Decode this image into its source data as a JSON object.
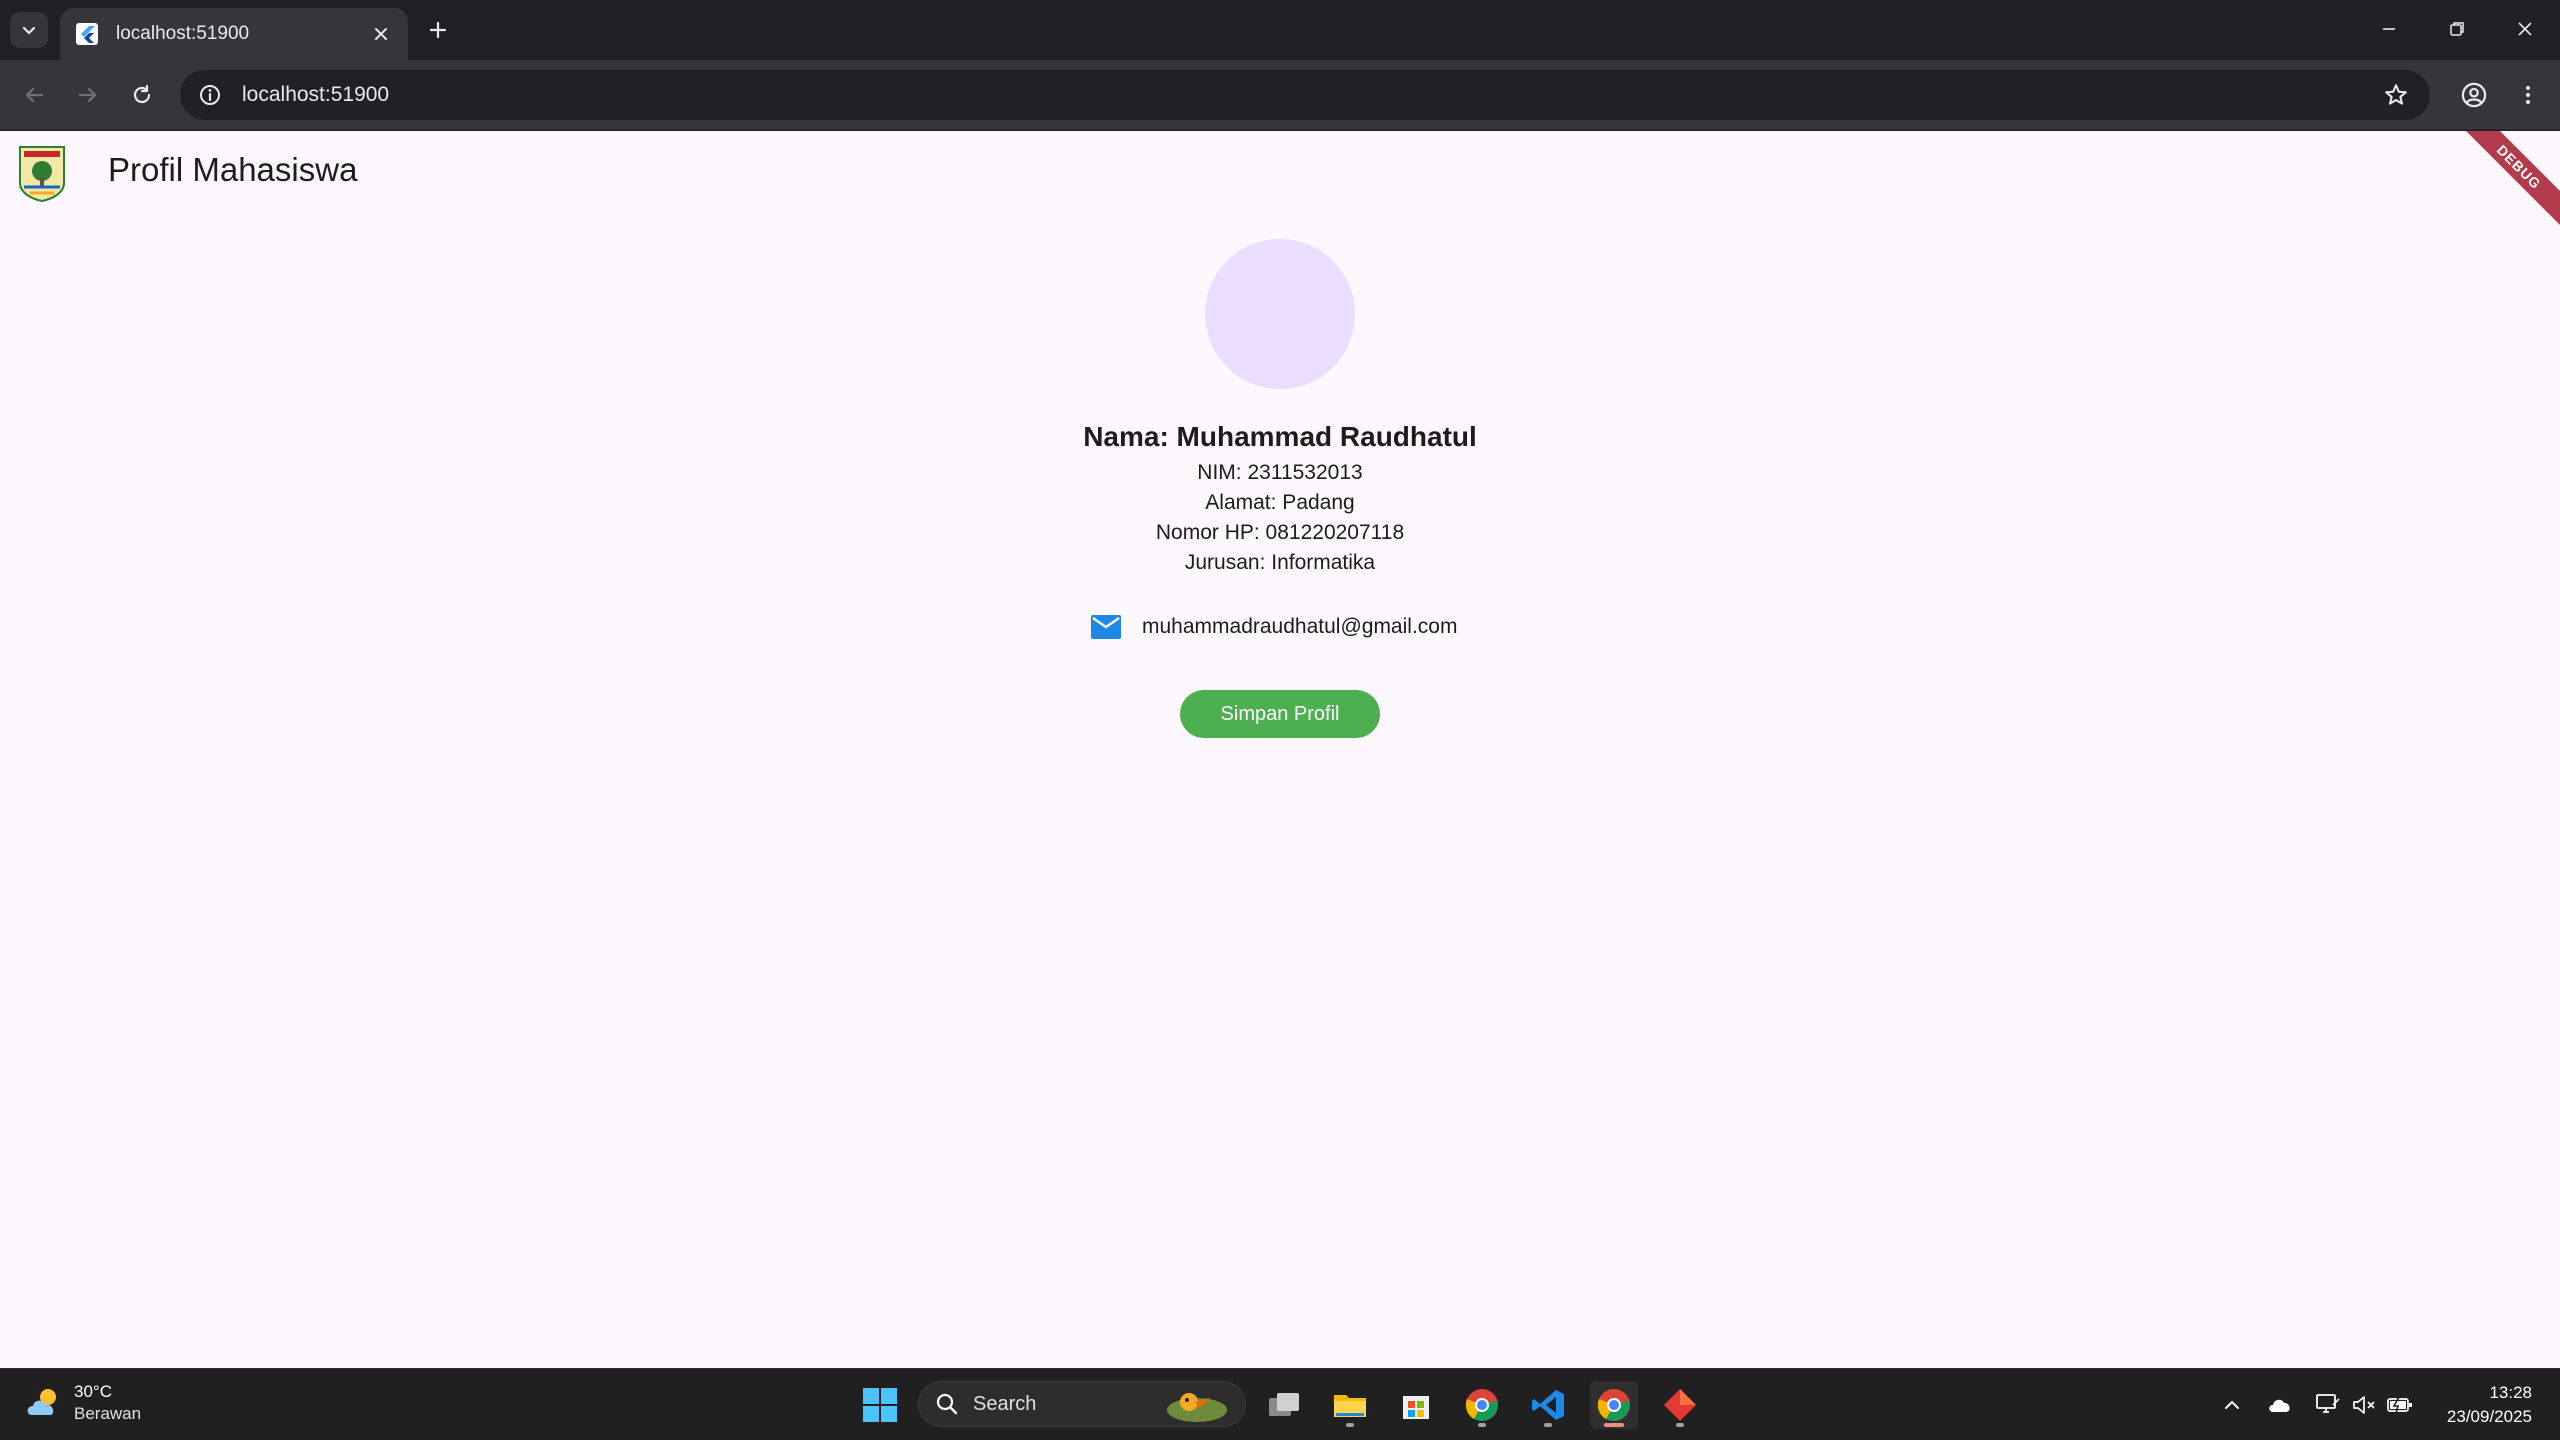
{
  "browser": {
    "tab_title": "localhost:51900",
    "url": "localhost:51900"
  },
  "app": {
    "title": "Profil Mahasiswa",
    "debug_label": "DEBUG"
  },
  "profile": {
    "name": "Nama: Muhammad Raudhatul",
    "nim": "NIM: 2311532013",
    "alamat": "Alamat: Padang",
    "phone": "Nomor HP: 081220207118",
    "jurusan": "Jurusan: Informatika",
    "email": "muhammadraudhatul@gmail.com",
    "save_button": "Simpan Profil"
  },
  "colors": {
    "page_background": "#fdf7fe",
    "avatar": "#eaddff",
    "button": "#4caf50",
    "email_icon": "#1e88e5"
  },
  "taskbar": {
    "weather_temp": "30°C",
    "weather_desc": "Berawan",
    "search_label": "Search",
    "time": "13:28",
    "date": "23/09/2025"
  }
}
